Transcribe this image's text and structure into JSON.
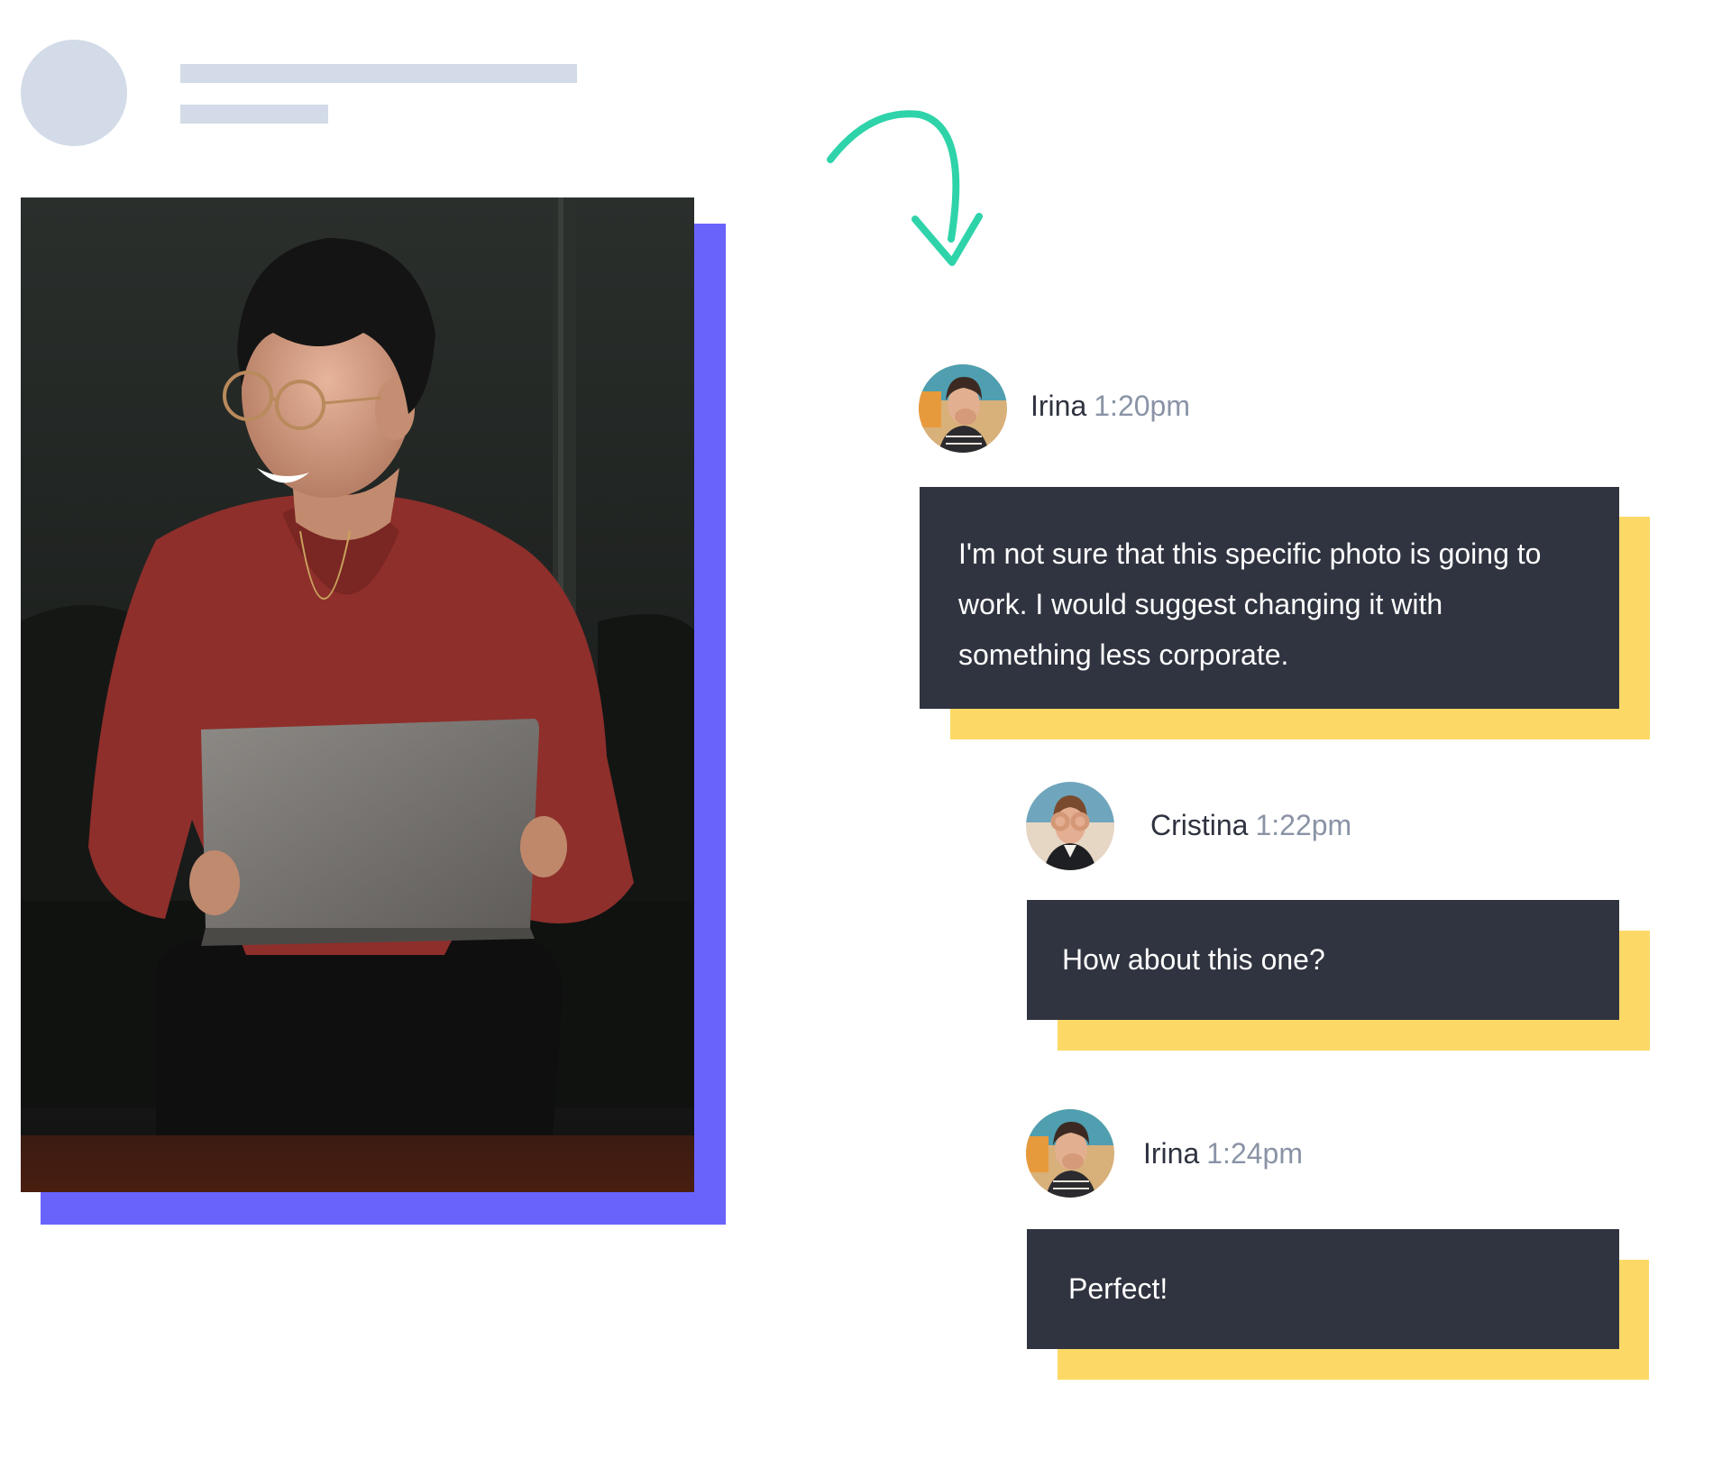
{
  "messages": [
    {
      "sender": "Irina",
      "time": "1:20pm",
      "text": "I'm not sure that this specific photo is going to work. I would suggest changing it with something less corporate."
    },
    {
      "sender": "Cristina",
      "time": "1:22pm",
      "text": "How about this one?"
    },
    {
      "sender": "Irina",
      "time": "1:24pm",
      "text": "Perfect!"
    }
  ],
  "colors": {
    "skeleton": "#d2dbe7",
    "photo_shadow": "#6a63fb",
    "arrow": "#2ed3a9",
    "bubble_bg": "#303440",
    "bubble_shadow": "#fcd966",
    "time_text": "#8a93a6"
  },
  "icons": {
    "arrow": "curved-arrow-down-icon"
  }
}
